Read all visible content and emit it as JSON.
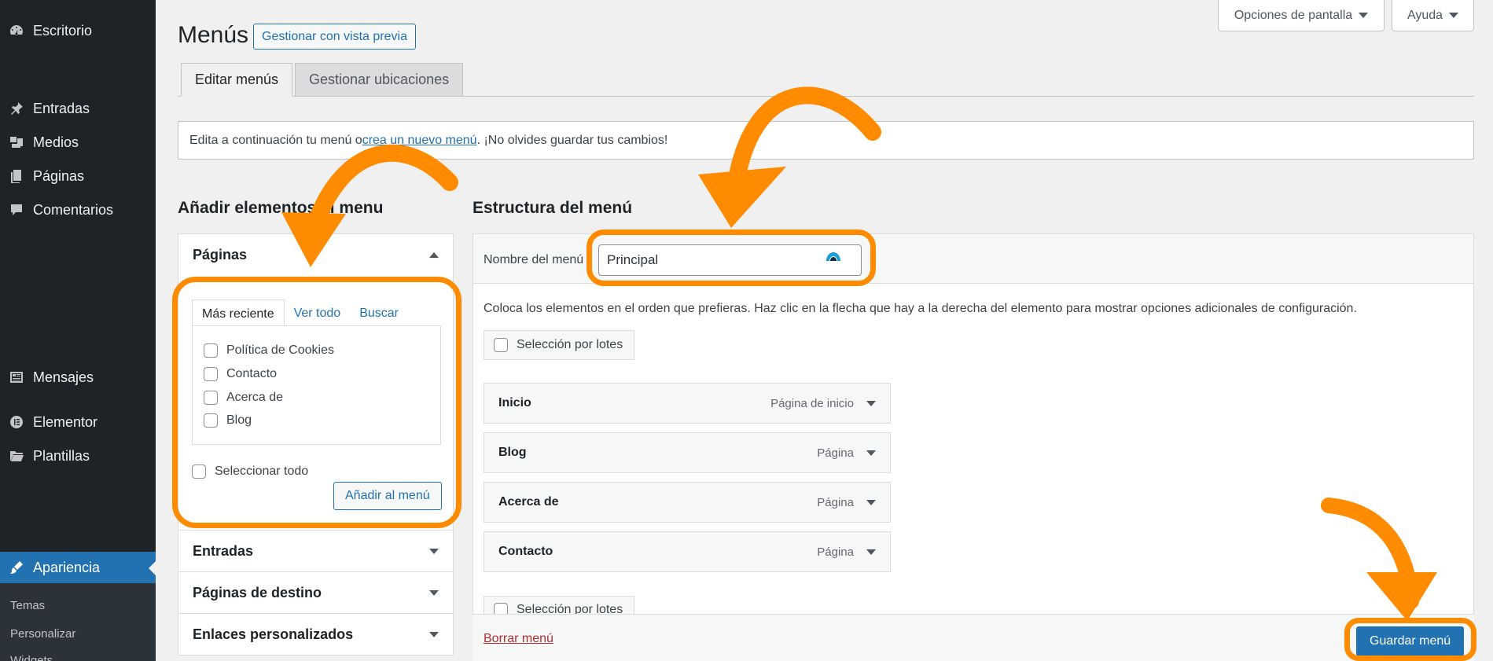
{
  "sidebar": {
    "items": [
      {
        "label": "Escritorio",
        "icon": "dashboard-icon"
      },
      {
        "label": "Entradas",
        "icon": "pin-icon"
      },
      {
        "label": "Medios",
        "icon": "media-icon"
      },
      {
        "label": "Páginas",
        "icon": "pages-icon"
      },
      {
        "label": "Comentarios",
        "icon": "comments-icon"
      },
      {
        "label": "Mensajes",
        "icon": "messages-icon"
      },
      {
        "label": "Elementor",
        "icon": "elementor-icon"
      },
      {
        "label": "Plantillas",
        "icon": "folder-icon"
      },
      {
        "label": "Apariencia",
        "icon": "brush-icon"
      }
    ],
    "submenu": [
      "Temas",
      "Personalizar",
      "Widgets"
    ]
  },
  "topbar": {
    "screen_options": "Opciones de pantalla",
    "help": "Ayuda"
  },
  "page": {
    "title": "Menús",
    "preview_button": "Gestionar con vista previa"
  },
  "tabs": {
    "edit": "Editar menús",
    "locations": "Gestionar ubicaciones"
  },
  "notice": {
    "before": "Edita a continuación tu menú o ",
    "link": "crea un nuevo menú",
    "after": ". ¡No olvides guardar tus cambios!"
  },
  "left": {
    "title": "Añadir elementos al menu",
    "pages_section": "Páginas",
    "page_tabs": [
      "Más reciente",
      "Ver todo",
      "Buscar"
    ],
    "pages": [
      "Política de Cookies",
      "Contacto",
      "Acerca de",
      "Blog"
    ],
    "select_all": "Seleccionar todo",
    "add_button": "Añadir al menú",
    "sections": [
      "Entradas",
      "Páginas de destino",
      "Enlaces personalizados"
    ]
  },
  "right": {
    "title": "Estructura del menú",
    "menu_name_label": "Nombre del menú",
    "menu_name_value": "Principal",
    "instructions": "Coloca los elementos en el orden que prefieras. Haz clic en la flecha que hay a la derecha del elemento para mostrar opciones adicionales de configuración.",
    "bulk_select": "Selección por lotes",
    "items": [
      {
        "title": "Inicio",
        "type": "Página de inicio"
      },
      {
        "title": "Blog",
        "type": "Página"
      },
      {
        "title": "Acerca de",
        "type": "Página"
      },
      {
        "title": "Contacto",
        "type": "Página"
      }
    ],
    "delete": "Borrar menú",
    "save": "Guardar menú"
  },
  "colors": {
    "sidebar": "#1d2327",
    "accent": "#2271b1",
    "highlight": "#ff8c00"
  }
}
